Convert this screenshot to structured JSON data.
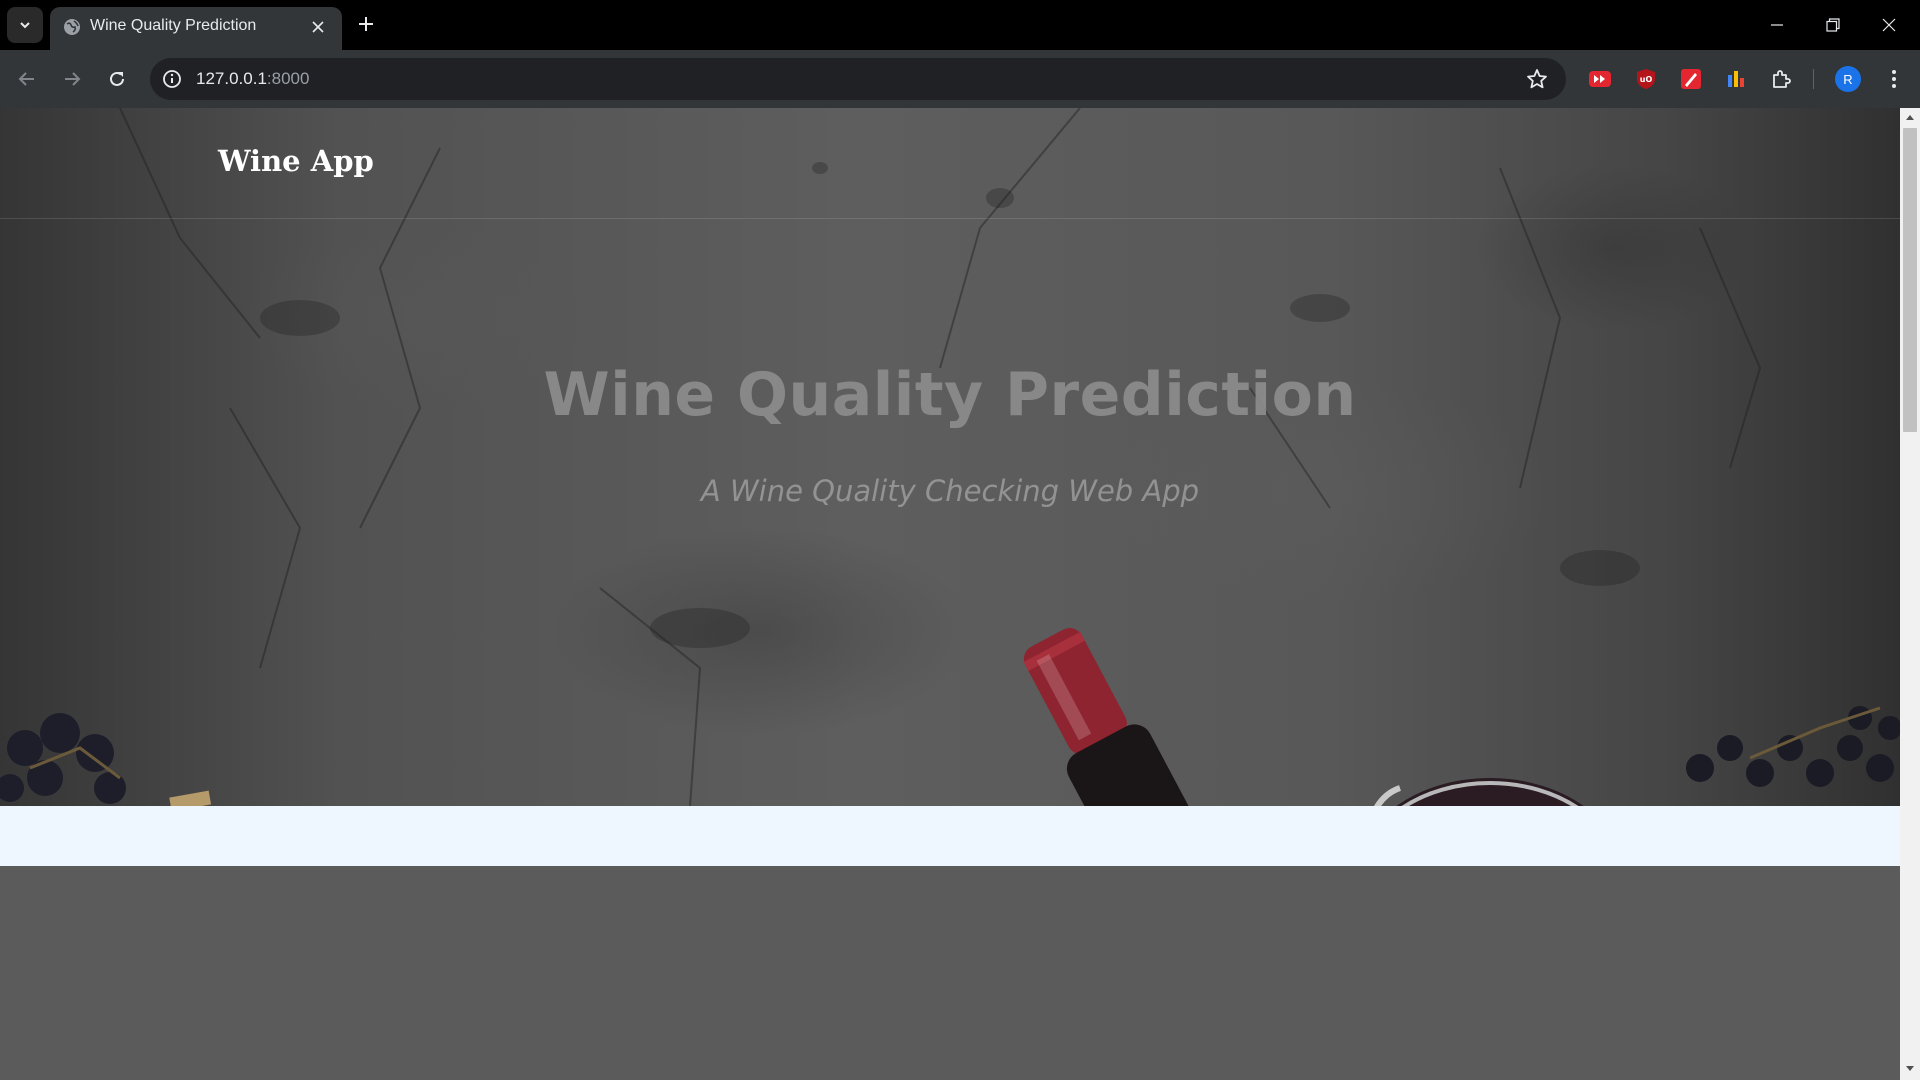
{
  "browser": {
    "tab": {
      "title": "Wine Quality Prediction",
      "favicon": "globe-icon",
      "close_icon": "close-icon"
    },
    "new_tab_icon": "plus-icon",
    "tab_search_icon": "chevron-down-icon",
    "window_controls": [
      "minimize-icon",
      "restore-icon",
      "close-icon"
    ],
    "nav": {
      "back_icon": "arrow-left-icon",
      "forward_icon": "arrow-right-icon",
      "reload_icon": "reload-icon"
    },
    "address_bar": {
      "host": "127.0.0.1",
      "port": ":8000",
      "site_info_icon": "info-icon",
      "bookmark_icon": "star-icon"
    },
    "extensions": [
      "youtube-extension-icon",
      "ublock-origin-icon",
      "pen-extension-icon",
      "bar-chart-extension-icon",
      "puzzle-icon"
    ],
    "profile": {
      "initial": "R",
      "color": "#1a73e8"
    },
    "menu_icon": "kebab-menu-icon"
  },
  "page": {
    "navbar": {
      "brand": "Wine App"
    },
    "hero": {
      "title": "Wine Quality Prediction",
      "subtitle": "A Wine Quality Checking Web App"
    },
    "colors": {
      "light_band": "#eef6ff",
      "lower_background": "#5b5b5b"
    }
  }
}
